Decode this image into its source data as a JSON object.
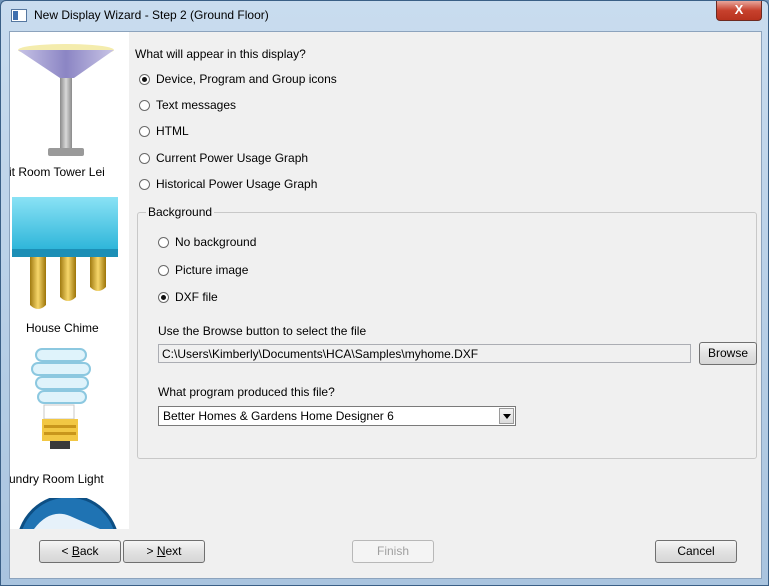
{
  "window": {
    "title": "New Display Wizard - Step 2 (Ground Floor)",
    "close_glyph": "X"
  },
  "gallery": {
    "items": [
      {
        "label": "it Room Tower Lei",
        "icon": "floor-lamp-icon"
      },
      {
        "label": "House Chime",
        "icon": "chime-icon"
      },
      {
        "label": "undry Room Light",
        "icon": "cfl-bulb-icon"
      },
      {
        "label": "",
        "icon": "partial-globe-icon"
      }
    ]
  },
  "display": {
    "question": "What will appear in this display?",
    "options": [
      {
        "label": "Device, Program and Group icons",
        "checked": true
      },
      {
        "label": "Text messages",
        "checked": false
      },
      {
        "label": "HTML",
        "checked": false
      },
      {
        "label": "Current Power Usage Graph",
        "checked": false
      },
      {
        "label": "Historical Power Usage Graph",
        "checked": false
      }
    ]
  },
  "background": {
    "title": "Background",
    "options": [
      {
        "label": "No background",
        "checked": false
      },
      {
        "label": "Picture image",
        "checked": false
      },
      {
        "label": "DXF file",
        "checked": true
      }
    ],
    "browse_hint": "Use the Browse button to select the file",
    "file_path": "C:\\Users\\Kimberly\\Documents\\HCA\\Samples\\myhome.DXF",
    "browse_label": "Browse",
    "program_question": "What program produced this file?",
    "program_selected": "Better Homes & Gardens Home Designer 6"
  },
  "buttons": {
    "back": {
      "prefix": "< ",
      "accel": "B",
      "rest": "ack"
    },
    "next": {
      "prefix": "> ",
      "accel": "N",
      "rest": "ext"
    },
    "finish": "Finish",
    "cancel": "Cancel"
  }
}
